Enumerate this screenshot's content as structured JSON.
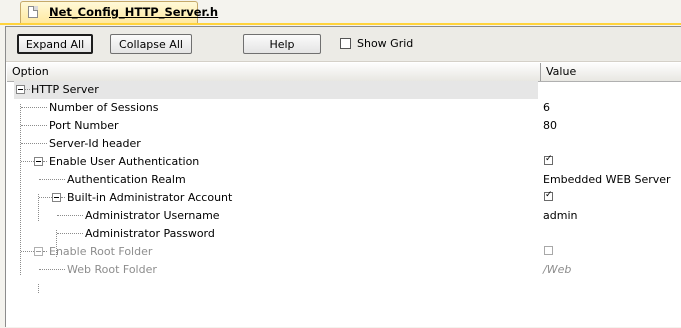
{
  "tab": {
    "title": "Net_Config_HTTP_Server.h",
    "icon": "document-icon"
  },
  "toolbar": {
    "expand_all": "Expand All",
    "collapse_all": "Collapse All",
    "help": "Help",
    "show_grid": "Show Grid",
    "show_grid_checked": false
  },
  "grid": {
    "columns": {
      "option": "Option",
      "value": "Value"
    },
    "rows": [
      {
        "label": "HTTP Server",
        "value": "",
        "level": 0,
        "expandable": true,
        "selected": true
      },
      {
        "label": "Number of Sessions",
        "value": "6",
        "level": 1
      },
      {
        "label": "Port Number",
        "value": "80",
        "level": 1
      },
      {
        "label": "Server-Id header",
        "value": "",
        "level": 1
      },
      {
        "label": "Enable User Authentication",
        "value": "",
        "checkbox": true,
        "checked": true,
        "level": 1,
        "expandable": true
      },
      {
        "label": "Authentication Realm",
        "value": "Embedded WEB Server",
        "level": 2
      },
      {
        "label": "Built-in Administrator Account",
        "value": "",
        "checkbox": true,
        "checked": true,
        "level": 2,
        "expandable": true
      },
      {
        "label": "Administrator Username",
        "value": "admin",
        "level": 3
      },
      {
        "label": "Administrator Password",
        "value": "",
        "level": 3
      },
      {
        "label": "Enable Root Folder",
        "value": "",
        "checkbox": true,
        "checked": false,
        "level": 1,
        "expandable": true,
        "disabled": true
      },
      {
        "label": "Web Root Folder",
        "value": "/Web",
        "level": 2,
        "disabled": true
      }
    ]
  },
  "colors": {
    "tab_accent": "#ffd33d",
    "disabled_text": "#8d8d8d",
    "selected_row": "#e6e6e6"
  }
}
